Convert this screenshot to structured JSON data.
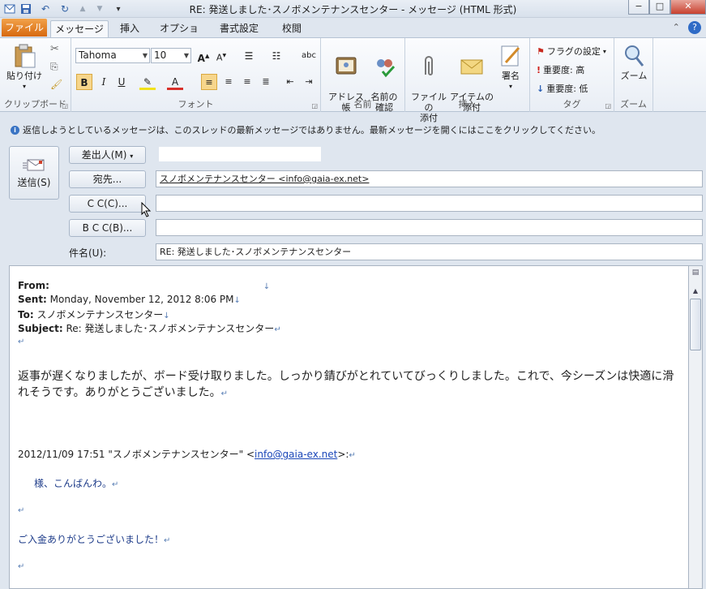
{
  "window": {
    "title": "RE: 発送しました･スノボメンテナンスセンター  -  メッセージ (HTML 形式)",
    "controls": {
      "minimize": "−",
      "maximize": "□",
      "close": "✕"
    }
  },
  "quick_access": {
    "save": "💾",
    "undo": "↶",
    "redo": "↻",
    "up": "▲",
    "down": "▼",
    "customize": "▾"
  },
  "tabs": [
    {
      "label": "ファイル"
    },
    {
      "label": "メッセージ"
    },
    {
      "label": "挿入"
    },
    {
      "label": "オプション"
    },
    {
      "label": "書式設定"
    },
    {
      "label": "校閲"
    }
  ],
  "ribbon": {
    "clipboard": {
      "paste": "貼り付け",
      "group_label": "クリップボード"
    },
    "font": {
      "font_name": "Tahoma",
      "font_size": "10",
      "bold": "B",
      "italic": "I",
      "underline": "U",
      "group_label": "フォント"
    },
    "names": {
      "address_book": "アドレス帳",
      "check_names": "名前の\n確認",
      "group_label": "名前"
    },
    "insert": {
      "attach_file": "ファイルの\n添付",
      "attach_item": "アイテムの\n添付",
      "signature": "署名",
      "group_label": "挿入"
    },
    "tags": {
      "follow_up": "フラグの設定",
      "high_importance": "重要度: 高",
      "low_importance": "重要度: 低",
      "group_label": "タグ"
    },
    "zoom": {
      "zoom": "ズーム",
      "group_label": "ズーム"
    }
  },
  "infobar": {
    "text": "返信しようとしているメッセージは、このスレッドの最新メッセージではありません。最新メッセージを開くにはここをクリックしてください。"
  },
  "compose": {
    "send": "送信(S)",
    "from": "差出人(M)",
    "to_btn": "宛先...",
    "to_value": "スノボメンテナンスセンター <info@gaia-ex.net>",
    "cc_btn": "C C(C)...",
    "cc_value": "",
    "bcc_btn": "B C C(B)...",
    "bcc_value": "",
    "subject_label": "件名(U):",
    "subject_value": "RE: 発送しました･スノボメンテナンスセンター"
  },
  "body": {
    "from_label": "From:",
    "sent_label": "Sent:",
    "sent_value": " Monday, November 12, 2012 8:06 PM",
    "to_label": "To:",
    "to_value": " スノボメンテナンスセンター",
    "subject_label": "Subject:",
    "subject_value": " Re: 発送しました･スノボメンテナンスセンター",
    "reply_line1": "返事が遅くなりましたが、ボード受け取りました。しっかり錆びがとれていてびっくりしました。これで、今シーズンは快適に滑",
    "reply_line2": "れそうです。ありがとうございました。",
    "quote_header_prefix": "2012/11/09 17:51 \"スノボメンテナンスセンター\" <",
    "quote_email": "info@gaia-ex.net",
    "quote_header_suffix": ">:",
    "greeting": "様、こんばんわ。",
    "thanks": "ご入金ありがとうございました！"
  }
}
